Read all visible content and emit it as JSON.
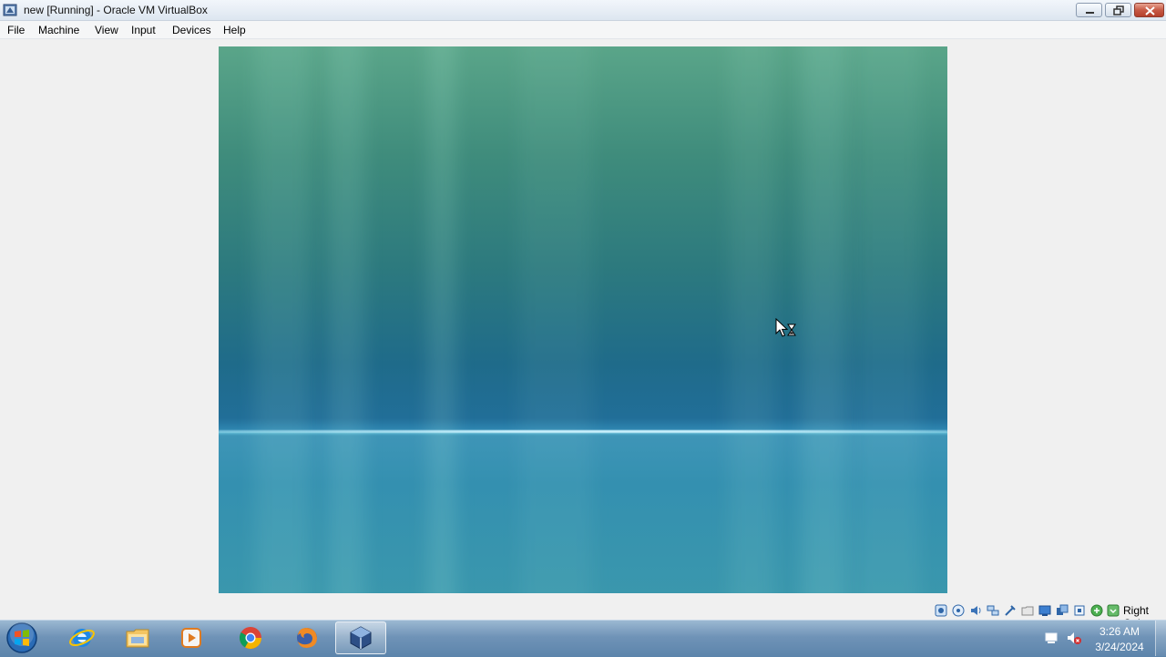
{
  "window": {
    "title": "new [Running] - Oracle VM VirtualBox",
    "controls": [
      "minimize",
      "restore",
      "close"
    ]
  },
  "menu": {
    "items": [
      "File",
      "Machine",
      "View",
      "Input",
      "Devices",
      "Help"
    ]
  },
  "guest_display": {
    "background": "Windows Vista aurora wallpaper",
    "cursor": "busy-arrow"
  },
  "status_bar": {
    "icons": [
      "hard-disk-icon",
      "optical-drive-icon",
      "audio-icon",
      "network-icon",
      "usb-icon",
      "shared-folders-icon",
      "display-icon",
      "recording-icon",
      "virtualization-icon",
      "mouse-integration-icon",
      "keyboard-capture-icon"
    ],
    "host_key": "Right Ctrl"
  },
  "taskbar": {
    "pinned": [
      "Internet Explorer",
      "Windows Explorer",
      "Windows Media Player",
      "Google Chrome",
      "Mozilla Firefox",
      "Oracle VM VirtualBox"
    ],
    "active": "Oracle VM VirtualBox",
    "clock": {
      "time": "3:26 AM",
      "date": "3/24/2024"
    }
  },
  "colors": {
    "titlebar": "#dde6f0",
    "window_bg": "#f0f0f0",
    "taskbar": "#6f93b7",
    "guest_top": "#5aa589",
    "guest_bottom": "#3a97ad"
  }
}
